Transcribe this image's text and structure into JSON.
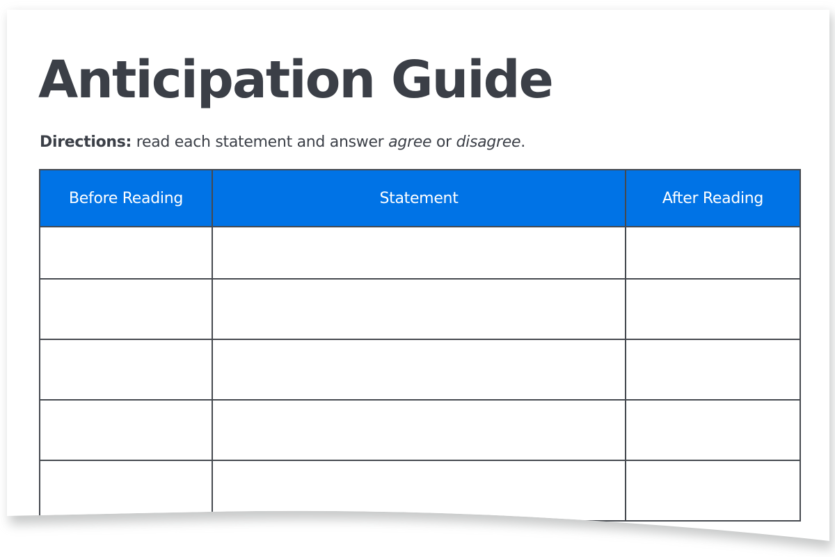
{
  "document": {
    "title": "Anticipation Guide",
    "directions": {
      "label": "Directions:",
      "text_before": " read each statement and answer ",
      "option_agree": "agree",
      "text_middle": " or ",
      "option_disagree": "disagree",
      "text_after": "."
    },
    "table": {
      "columns": [
        "Before Reading",
        "Statement",
        "After Reading"
      ],
      "rows": [
        [
          "",
          "",
          ""
        ],
        [
          "",
          "",
          ""
        ],
        [
          "",
          "",
          ""
        ],
        [
          "",
          "",
          ""
        ],
        [
          "",
          "",
          ""
        ]
      ]
    }
  },
  "colors": {
    "header_background": "#0073e6",
    "header_text": "#ffffff",
    "border": "#45494f",
    "text": "#3b3f47"
  }
}
